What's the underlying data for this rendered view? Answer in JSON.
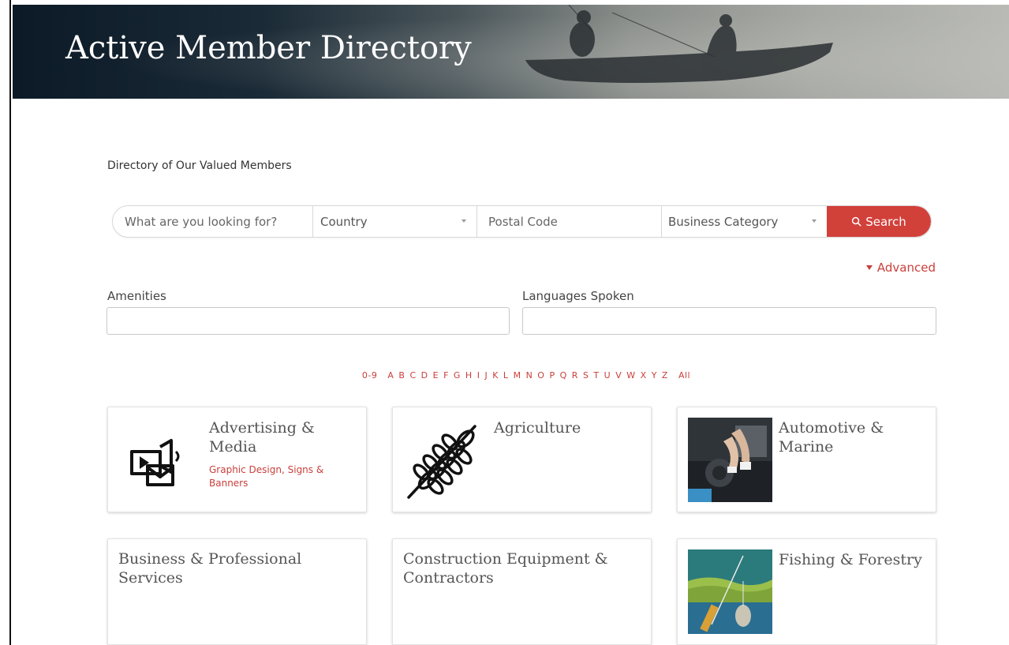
{
  "header": {
    "title": "Active Member Directory"
  },
  "intro": {
    "text": "Directory of Our Valued Members"
  },
  "search": {
    "keyword_placeholder": "What are you looking for?",
    "country_value": "Country",
    "postal_placeholder": "Postal Code",
    "category_value": "Business Category",
    "button_label": "Search"
  },
  "advanced": {
    "label": "Advanced"
  },
  "filters": {
    "amenities_label": "Amenities",
    "languages_label": "Languages Spoken"
  },
  "alphabet": {
    "numeric": "0-9",
    "letters": [
      "A",
      "B",
      "C",
      "D",
      "E",
      "F",
      "G",
      "H",
      "I",
      "J",
      "K",
      "L",
      "M",
      "N",
      "O",
      "P",
      "Q",
      "R",
      "S",
      "T",
      "U",
      "V",
      "W",
      "X",
      "Y",
      "Z"
    ],
    "all": "All"
  },
  "categories": [
    {
      "title": "Advertising & Media",
      "subtitle": "Graphic Design, Signs & Banners",
      "icon": "media-icon"
    },
    {
      "title": "Agriculture",
      "subtitle": "",
      "icon": "wheat-icon"
    },
    {
      "title": "Automotive & Marine",
      "subtitle": "",
      "icon": "automotive-photo"
    },
    {
      "title": "Business & Professional Services",
      "subtitle": "",
      "icon": ""
    },
    {
      "title": "Construction Equipment & Contractors",
      "subtitle": "",
      "icon": ""
    },
    {
      "title": "Fishing & Forestry",
      "subtitle": "",
      "icon": "fishing-photo"
    }
  ],
  "colors": {
    "accent": "#c9403b",
    "button": "#d2403a",
    "hero_dark": "#0c1a27"
  }
}
